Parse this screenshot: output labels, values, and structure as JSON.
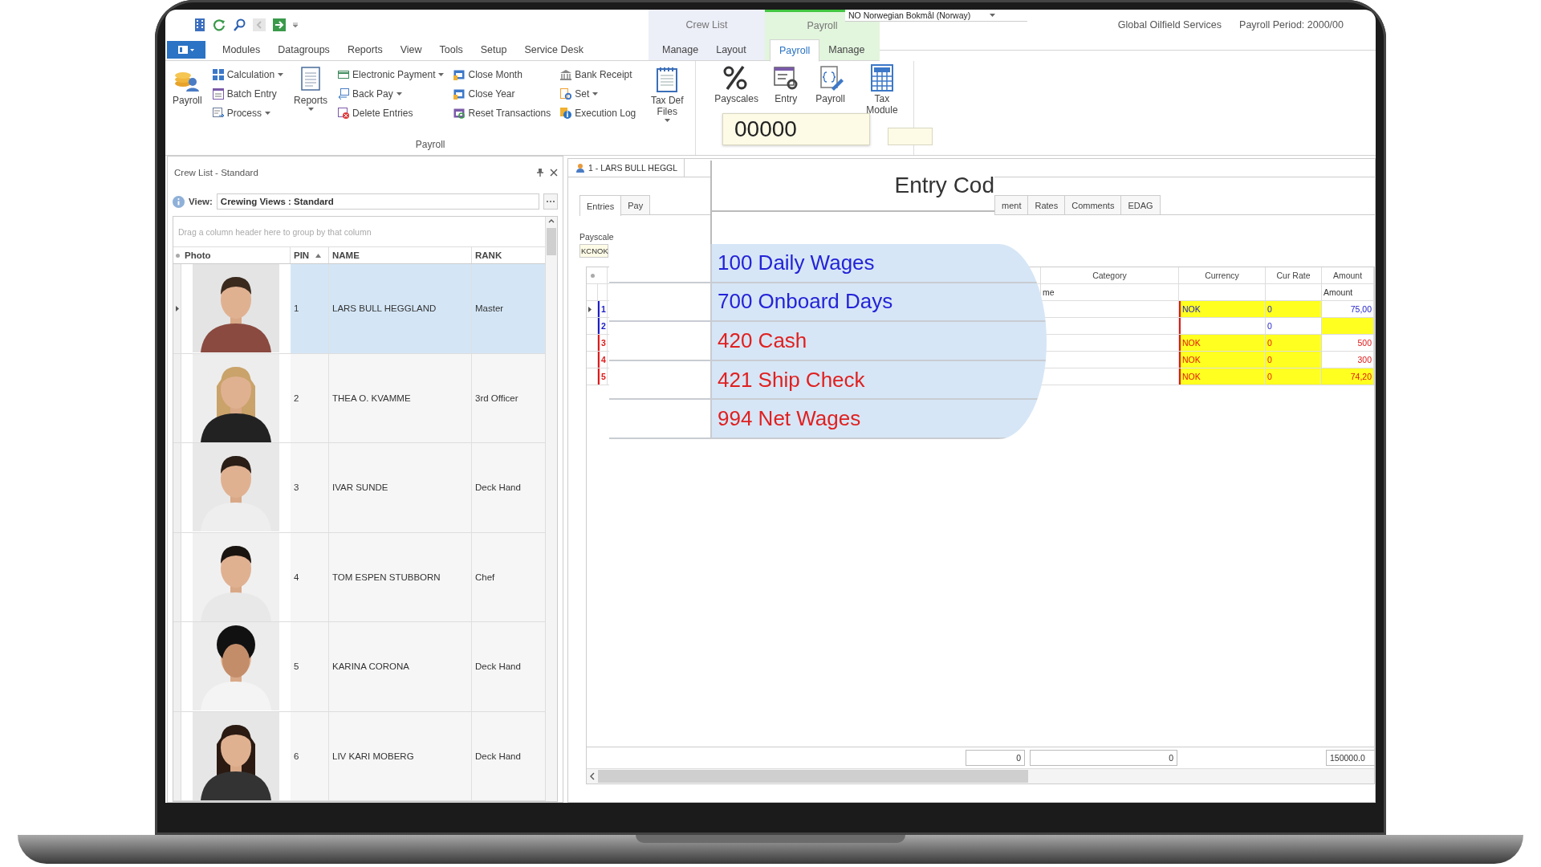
{
  "language": "NO Norwegian Bokmål (Norway)",
  "company": "Global Oilfield Services",
  "period": "Payroll Period: 2000/00",
  "menu_tabs": [
    {
      "label": "Modules",
      "selected": false
    },
    {
      "label": "Datagroups",
      "selected": false
    },
    {
      "label": "Reports",
      "selected": false
    },
    {
      "label": "View",
      "selected": false
    },
    {
      "label": "Tools",
      "selected": false
    },
    {
      "label": "Setup",
      "selected": false
    },
    {
      "label": "Service Desk",
      "selected": false
    }
  ],
  "context_tabs": [
    {
      "label": "Crew List",
      "color": "#eceef8",
      "tabs": [
        {
          "label": "Manage",
          "selected": false
        },
        {
          "label": "Layout",
          "selected": false
        }
      ]
    },
    {
      "label": "Payroll",
      "color": "#e2f5dd",
      "tabs": [
        {
          "label": "Payroll",
          "selected": true
        },
        {
          "label": "Manage",
          "selected": false
        }
      ]
    }
  ],
  "ribbon": {
    "group_label": "Payroll",
    "columns": [
      {
        "kind": "large",
        "label": "Payroll",
        "dropdown": false
      },
      {
        "kind": "stack",
        "items": [
          {
            "label": "Calculation",
            "dropdown": true
          },
          {
            "label": "Batch Entry",
            "dropdown": false
          },
          {
            "label": "Process",
            "dropdown": true
          }
        ]
      },
      {
        "kind": "large",
        "label": "Reports",
        "dropdown": true
      },
      {
        "kind": "stack",
        "items": [
          {
            "label": "Electronic Payment",
            "dropdown": true
          },
          {
            "label": "Back Pay",
            "dropdown": true
          },
          {
            "label": "Delete Entries",
            "dropdown": false
          }
        ]
      },
      {
        "kind": "stack",
        "items": [
          {
            "label": "Close Month",
            "dropdown": false
          },
          {
            "label": "Close Year",
            "dropdown": false
          },
          {
            "label": "Reset Transactions",
            "dropdown": false
          }
        ]
      },
      {
        "kind": "stack",
        "items": [
          {
            "label": "Bank Receipt",
            "dropdown": false
          },
          {
            "label": "Set",
            "dropdown": true
          },
          {
            "label": "Execution Log",
            "dropdown": false
          }
        ]
      },
      {
        "kind": "large",
        "label": "Tax Def Files",
        "dropdown": true
      }
    ],
    "second_group": [
      {
        "label": "Payscales"
      },
      {
        "label": "Entry"
      },
      {
        "label": "Payroll"
      },
      {
        "label": "Tax Module"
      }
    ]
  },
  "crew_panel": {
    "title": "Crew List - Standard",
    "view_label": "View:",
    "view_value": "Crewing Views : Standard",
    "hint": "Drag a column header here to group by that column",
    "columns": [
      {
        "label": "Photo",
        "sorted": false
      },
      {
        "label": "PIN",
        "sorted": true
      },
      {
        "label": "NAME",
        "sorted": false
      },
      {
        "label": "RANK",
        "sorted": false
      }
    ],
    "rows": [
      {
        "pin": "1",
        "name": "LARS BULL HEGGLAND",
        "rank": "Master",
        "selected": true
      },
      {
        "pin": "2",
        "name": "THEA O. KVAMME",
        "rank": "3rd Officer",
        "selected": false
      },
      {
        "pin": "3",
        "name": "IVAR  SUNDE",
        "rank": "Deck Hand",
        "selected": false
      },
      {
        "pin": "4",
        "name": "TOM ESPEN  STUBBORN",
        "rank": "Chef",
        "selected": false
      },
      {
        "pin": "5",
        "name": "KARINA  CORONA",
        "rank": "Deck Hand",
        "selected": false
      },
      {
        "pin": "6",
        "name": "LIV KARI  MOBERG",
        "rank": "Deck Hand",
        "selected": false
      }
    ]
  },
  "record": {
    "doc_tab": "1 - LARS BULL HEGGL",
    "sub_tabs": [
      {
        "label": "Entries",
        "selected": true
      },
      {
        "label": "Pay",
        "selected": false
      },
      {
        "label": "ment",
        "selected": false
      },
      {
        "label": "Rates",
        "selected": false
      },
      {
        "label": "Comments",
        "selected": false
      },
      {
        "label": "EDAG",
        "selected": false
      }
    ],
    "payscale_label": "Payscale",
    "payscale_value": "KCNOK",
    "grid": {
      "columns": [
        "Category",
        "Currency",
        "Cur Rate",
        "Amount"
      ],
      "subheader": [
        "me",
        "Amount"
      ],
      "rows": [
        {
          "num": "1",
          "color": "#1c1cc8",
          "current": true,
          "currency": {
            "text": "NOK",
            "highlight": true
          },
          "rate": {
            "text": "0",
            "highlight": true
          },
          "amount": {
            "text": "75,00",
            "highlight": false
          }
        },
        {
          "num": "2",
          "color": "#1c1cc8",
          "current": false,
          "currency": {
            "highlight": false
          },
          "rate": {
            "text": "0",
            "highlight": false
          },
          "amount": {
            "highlight": true
          }
        },
        {
          "num": "3",
          "color": "#e01818",
          "current": false,
          "currency": {
            "text": "NOK",
            "highlight": true
          },
          "rate": {
            "text": "0",
            "highlight": true
          },
          "amount": {
            "text": "500",
            "highlight": false
          }
        },
        {
          "num": "4",
          "color": "#e01818",
          "current": false,
          "currency": {
            "text": "NOK",
            "highlight": true
          },
          "rate": {
            "text": "0",
            "highlight": true
          },
          "amount": {
            "text": "300",
            "highlight": false
          }
        },
        {
          "num": "5",
          "color": "#e01818",
          "current": false,
          "currency": {
            "text": "NOK",
            "highlight": true
          },
          "rate": {
            "text": "0",
            "highlight": true
          },
          "amount": {
            "text": "74,20",
            "highlight": true
          }
        }
      ],
      "footer": [
        "0",
        "0",
        "150000.0"
      ]
    }
  },
  "zoom": {
    "ribbon_value": "00000",
    "heading": "Entry Cod",
    "entries": [
      {
        "text": "100 Daily Wages",
        "color": "#2323d8"
      },
      {
        "text": "700 Onboard Days",
        "color": "#2323d8"
      },
      {
        "text": "420 Cash",
        "color": "#e02020"
      },
      {
        "text": "421 Ship Check",
        "color": "#e02020"
      },
      {
        "text": "994 Net Wages",
        "color": "#e02020"
      }
    ]
  }
}
